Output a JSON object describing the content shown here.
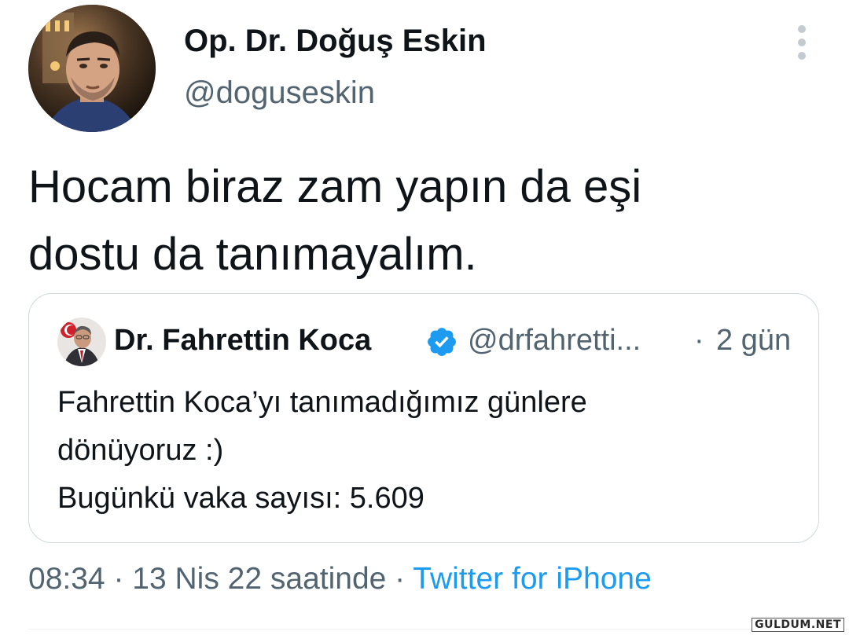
{
  "tweet": {
    "author": {
      "name": "Op. Dr. Doğuş Eskin",
      "handle": "@doguseskin",
      "avatar": "profile-photo"
    },
    "text_lines": [
      "Hocam biraz zam yapın da eşi",
      "dostu da tanımayalım."
    ],
    "quoted": {
      "author_name": "Dr. Fahrettin Koca",
      "verified": true,
      "handle": "@drfahretti...",
      "separator": "·",
      "time": "2 gün",
      "text_lines": [
        "Fahrettin Koca’yı tanımadığımız günlere",
        "dönüyoruz :)",
        "Bugünkü vaka sayısı: 5.609"
      ]
    },
    "meta": {
      "time": "08:34",
      "sep1": " · ",
      "date": "13 Nis 22 saatinde",
      "sep2": " · ",
      "source": "Twitter for iPhone"
    }
  },
  "watermark": "GULDUM.NET",
  "colors": {
    "primary_text": "#0f1419",
    "secondary_text": "#536471",
    "link": "#1d9bf0",
    "verified_badge": "#1d9bf0",
    "border": "#cfd9de"
  },
  "icons": {
    "more": "more-vertical-icon",
    "verified": "verified-badge-icon"
  }
}
